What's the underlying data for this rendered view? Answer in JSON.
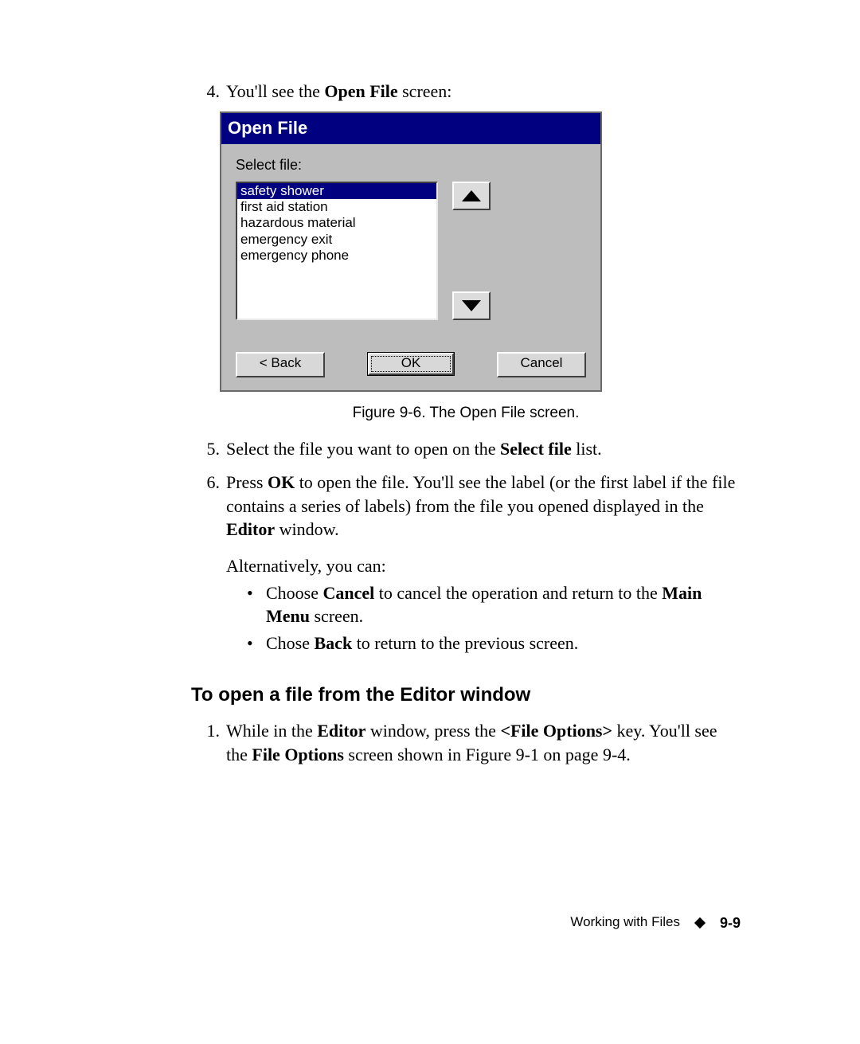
{
  "steps": {
    "s4": {
      "num": "4.",
      "pre": "You'll see the ",
      "bold": "Open File",
      "post": " screen:"
    },
    "s5": {
      "num": "5.",
      "pre": "Select the file you want to open on the ",
      "bold": "Select file",
      "post": " list."
    },
    "s6": {
      "num": "6.",
      "t1": "Press ",
      "b1": "OK",
      "t2": " to open the file. You'll see the label (or the first label if the file contains a series of labels) from the file you opened displayed in the ",
      "b2": "Editor",
      "t3": " window.",
      "alt": "Alternatively, you can:",
      "bullets": {
        "a": {
          "t1": "Choose ",
          "b1": "Cancel",
          "t2": " to cancel the operation and return to the ",
          "b2": "Main Menu",
          "t3": " screen."
        },
        "b": {
          "t1": "Chose ",
          "b1": "Back",
          "t2": " to return to the previous screen."
        }
      }
    }
  },
  "section2": {
    "heading": "To open a file from the Editor window",
    "s1": {
      "num": "1.",
      "t1": "While in the ",
      "b1": "Editor",
      "t2": " window, press the ",
      "b2": "<File Options>",
      "t3": " key. You'll see the ",
      "b3": "File Options",
      "t4": " screen shown in Figure 9-1 on page 9-4."
    }
  },
  "dialog": {
    "title": "Open File",
    "label": "Select file:",
    "files": {
      "f0": "safety shower",
      "f1": "first aid station",
      "f2": "hazardous material",
      "f3": "emergency exit",
      "f4": "emergency phone"
    },
    "buttons": {
      "back": "< Back",
      "ok": "OK",
      "cancel": "Cancel"
    }
  },
  "caption": "Figure 9-6. The Open File screen.",
  "footer": {
    "title": "Working with Files",
    "page": "9-9"
  },
  "chart_data": null
}
